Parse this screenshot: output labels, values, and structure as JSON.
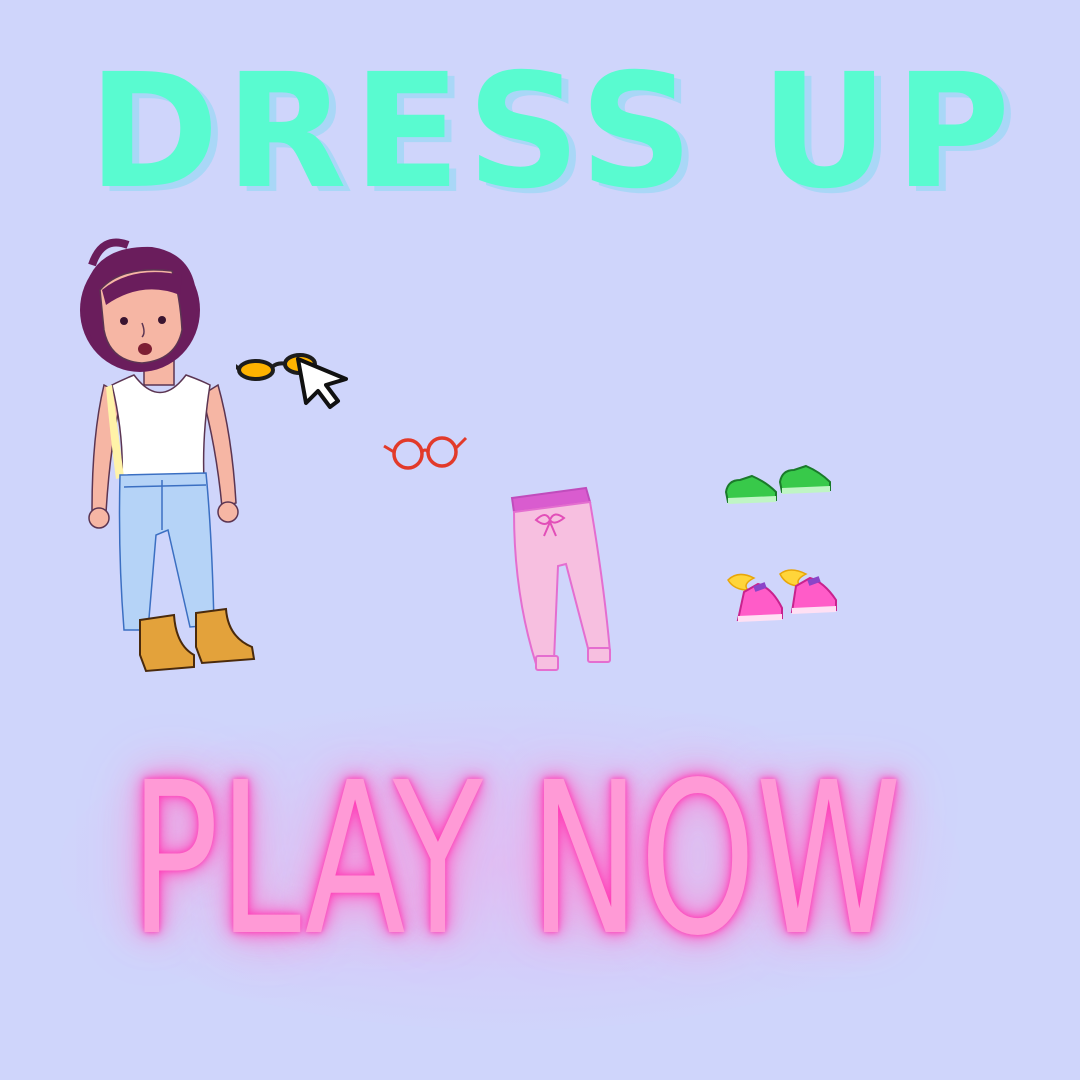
{
  "title": "DRESS UP",
  "play_button": "PLAY NOW",
  "colors": {
    "background": "#cfd5fb",
    "title": "#59fbd0",
    "title_shadow": "#a9d7f7",
    "play_text": "#ff9ad6",
    "play_glow": "#ff3fb8"
  },
  "items": [
    {
      "name": "orange-sunglasses",
      "icon": "sunglasses-icon"
    },
    {
      "name": "red-round-glasses",
      "icon": "glasses-icon"
    },
    {
      "name": "pink-jogger-pants",
      "icon": "pants-icon"
    },
    {
      "name": "green-sneakers",
      "icon": "sneakers-icon"
    },
    {
      "name": "winged-pink-sneakers",
      "icon": "winged-sneakers-icon"
    }
  ]
}
